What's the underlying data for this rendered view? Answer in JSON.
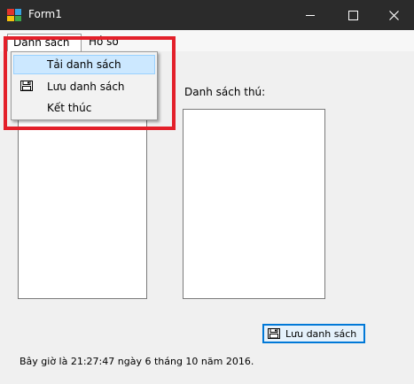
{
  "window": {
    "title": "Form1",
    "controls": {
      "minimize": "minimize",
      "maximize": "maximize",
      "close": "close"
    }
  },
  "menubar": {
    "items": [
      {
        "label": "Danh sách",
        "open": true
      },
      {
        "label": "Hồ sơ",
        "open": false
      }
    ]
  },
  "dropdown": {
    "items": [
      {
        "label": "Tải danh sách",
        "highlighted": true,
        "icon": null
      },
      {
        "label": "Lưu danh sách",
        "highlighted": false,
        "icon": "floppy-disk-icon"
      },
      {
        "label": "Kết thúc",
        "highlighted": false,
        "icon": null
      }
    ]
  },
  "main": {
    "right_list_label": "Danh sách thú:",
    "save_button_label": "Lưu danh sách",
    "status_text": "Bây giờ là 21:27:47 ngày 6 tháng 10 năm 2016."
  },
  "colors": {
    "titlebar": "#2b2b2b",
    "highlight_box": "#e3202a",
    "menu_hover": "#cce8ff",
    "button_border": "#0078d7"
  }
}
